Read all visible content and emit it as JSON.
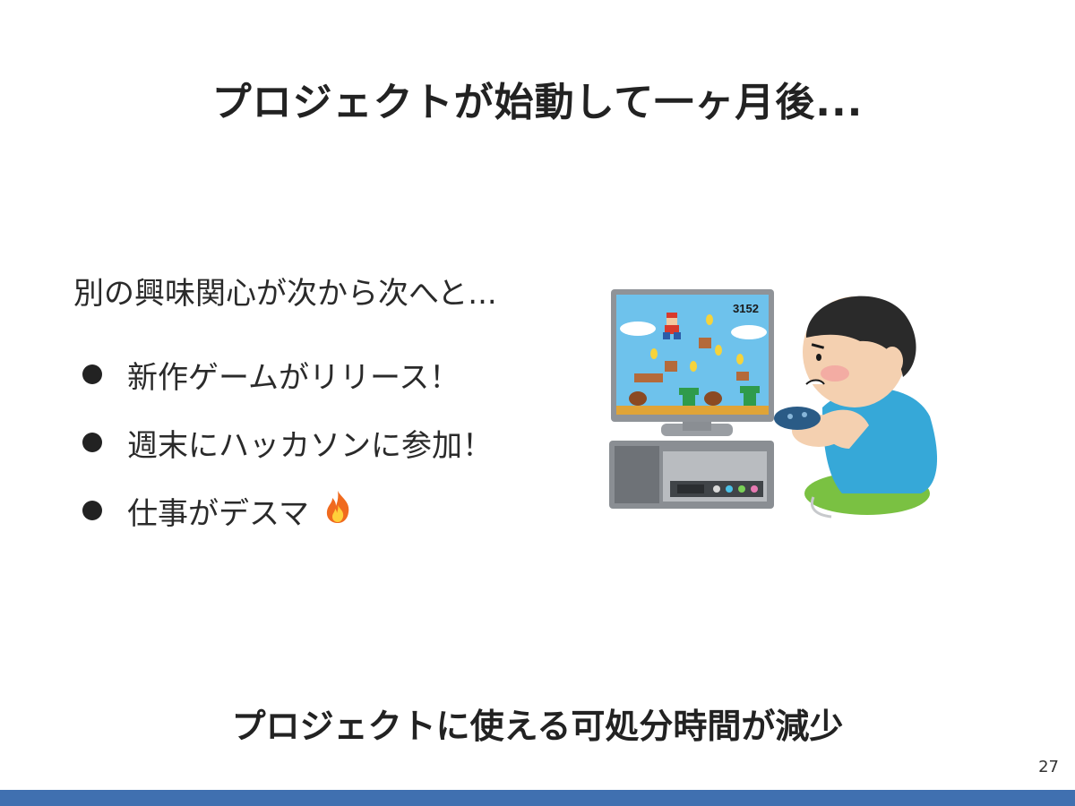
{
  "slide": {
    "title": "プロジェクトが始動して一ヶ月後...",
    "lead": "別の興味関心が次から次へと...",
    "bullets": [
      {
        "text": "新作ゲームがリリース！"
      },
      {
        "text": "週末にハッカソンに参加！"
      },
      {
        "text": "仕事がデスマ",
        "icon": "fire-icon"
      }
    ],
    "illustration": {
      "icon": "person-playing-video-game-illustration",
      "score": "3152"
    },
    "conclusion": "プロジェクトに使える可処分時間が減少",
    "page_number": "27"
  },
  "colors": {
    "footer_bar": "#4070b0",
    "text": "#222222"
  }
}
